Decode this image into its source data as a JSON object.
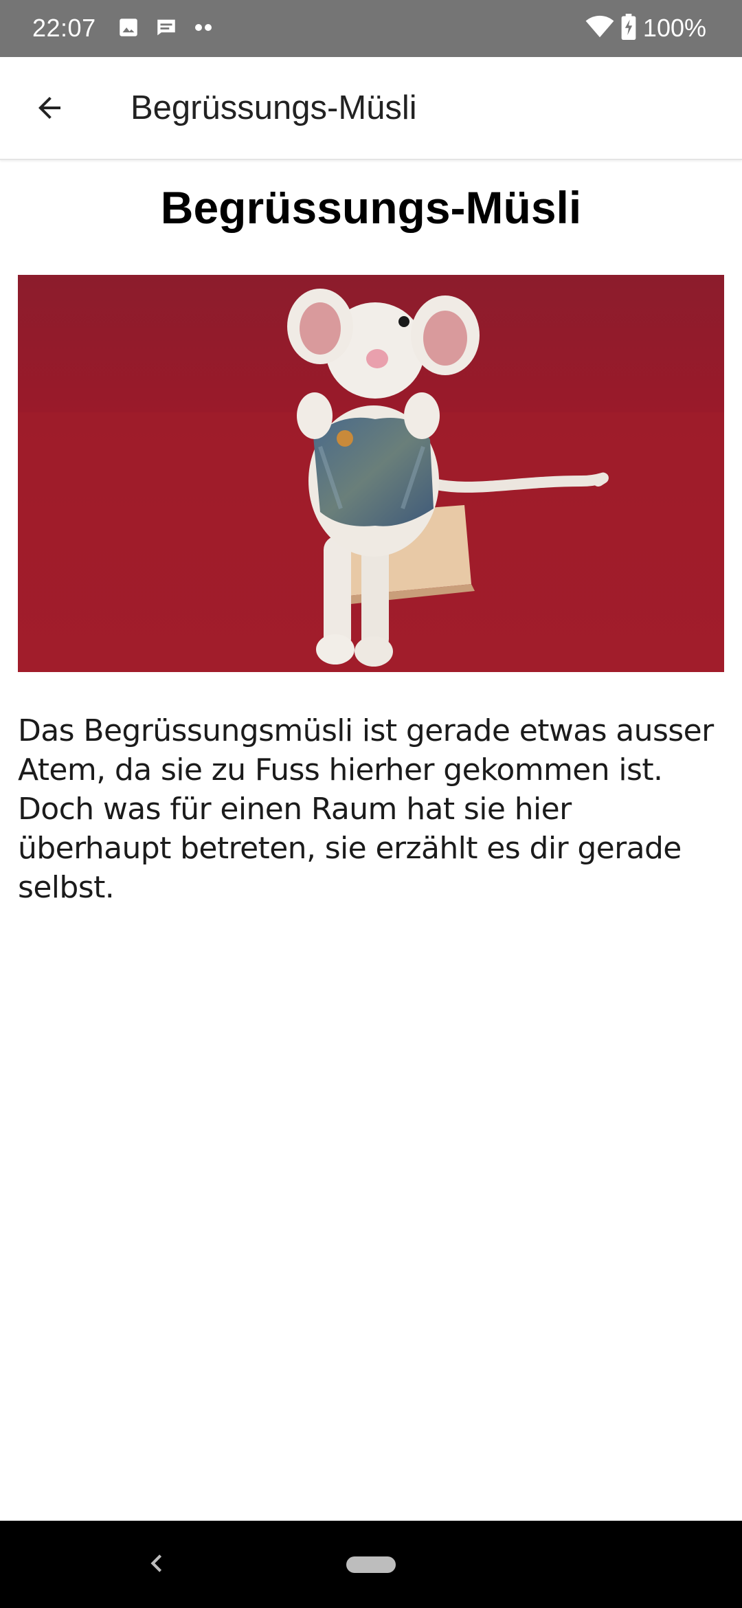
{
  "status_bar": {
    "time": "22:07",
    "left_icons": [
      "image-icon",
      "message-icon",
      "more-dots-icon"
    ],
    "right_icons": [
      "wifi-icon",
      "battery-charging-icon"
    ],
    "battery": "100%"
  },
  "app_bar": {
    "back_icon": "arrow-left-icon",
    "title": "Begrüssungs-Müsli"
  },
  "content": {
    "heading": "Begrüssungs-Müsli",
    "image": {
      "subject": "crocheted white mouse wearing a knitted multicolor vest, sitting on a wooden block",
      "background_color": "#9e1a28"
    },
    "description": "Das Begrüssungsmüsli ist gerade etwas ausser Atem, da sie zu Fuss hierher gekommen ist. Doch was für einen Raum hat sie hier überhaupt betreten, sie erzählt es dir gerade selbst."
  },
  "nav_bar": {
    "back_icon": "chevron-left-icon",
    "home_icon": "home-pill-icon"
  },
  "colors": {
    "status_bar": "#757575",
    "app_bar": "#ffffff",
    "nav_bar": "#000000",
    "text": "#1b1b1b"
  }
}
